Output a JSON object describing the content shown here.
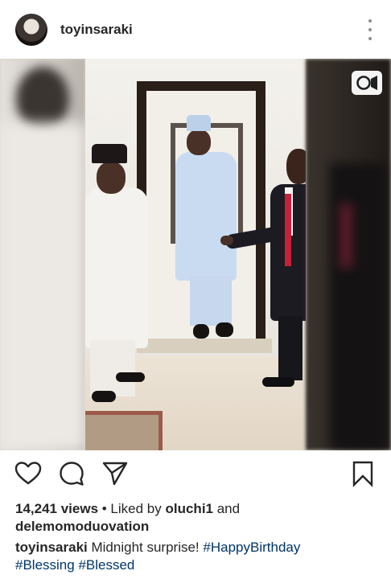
{
  "post": {
    "username": "toyinsaraki",
    "more_icon": "more-vertical-icon",
    "media_type_icon": "video-camera-icon"
  },
  "actions": {
    "like_icon": "heart-outline-icon",
    "comment_icon": "comment-outline-icon",
    "share_icon": "send-outline-icon",
    "save_icon": "bookmark-outline-icon"
  },
  "stats": {
    "views": "14,241 views",
    "liked_by_prefix": " • Liked by ",
    "liked_by_user": "oluchi1",
    "liked_by_and": " and",
    "liked_by_second": "delemomoduovation"
  },
  "caption": {
    "username": "toyinsaraki",
    "text": " Midnight surprise! ",
    "hashtag_1": "#HappyBirthday",
    "hashtag_2": "#Blessing",
    "hashtag_3": "#Blessed"
  },
  "colors": {
    "text": "#262626",
    "hashtag": "#003569",
    "secondary_icon": "#8e8e8e"
  }
}
